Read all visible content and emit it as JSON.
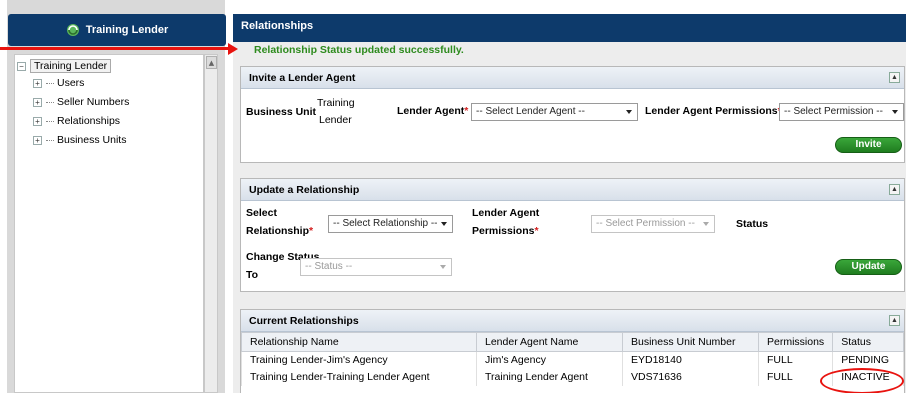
{
  "sidebar": {
    "title": "Training Lender",
    "tree": {
      "root": "Training Lender",
      "children": [
        "Users",
        "Seller Numbers",
        "Relationships",
        "Business Units"
      ]
    }
  },
  "main": {
    "title": "Relationships",
    "success_message": "Relationship Status updated successfully."
  },
  "invite": {
    "title": "Invite a Lender Agent",
    "business_unit_label": "Business Unit",
    "business_unit_value_line1": "Training",
    "business_unit_value_line2": "Lender",
    "lender_agent_label": "Lender Agent",
    "lender_agent_select": "-- Select Lender Agent --",
    "permissions_label": "Lender Agent Permissions",
    "permissions_select": "-- Select Permission --",
    "invite_button": "Invite"
  },
  "update": {
    "title": "Update a Relationship",
    "select_label_line1": "Select",
    "select_label_line2": "Relationship",
    "relationship_select": "-- Select Relationship --",
    "permissions_label_line1": "Lender Agent",
    "permissions_label_line2": "Permissions",
    "permissions_select": "-- Select Permission --",
    "status_label": "Status",
    "change_status_line1": "Change Status",
    "change_status_line2": "To",
    "status_select": "-- Status --",
    "update_button": "Update"
  },
  "current": {
    "title": "Current Relationships",
    "columns": [
      "Relationship Name",
      "Lender Agent Name",
      "Business Unit Number",
      "Permissions",
      "Status"
    ],
    "rows": [
      [
        "Training Lender-Jim's Agency",
        "Jim's Agency",
        "EYD18140",
        "FULL",
        "PENDING"
      ],
      [
        "Training Lender-Training Lender Agent",
        "Training Lender Agent",
        "VDS71636",
        "FULL",
        "INACTIVE"
      ]
    ]
  },
  "required_marker": "*",
  "collapse_glyph": "▲",
  "expand_glyph": "+",
  "collapse_tree_glyph": "−",
  "colors": {
    "header_bg": "#0d3a6b",
    "success_text": "#2e8b1e",
    "button_green": "#2a8f2a",
    "annotation_red": "#e8130f"
  }
}
